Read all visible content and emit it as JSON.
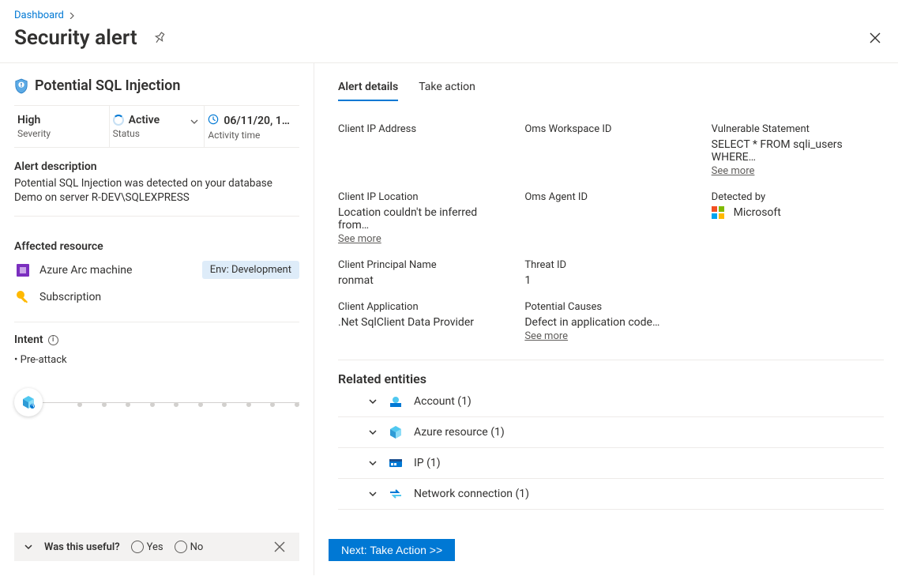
{
  "breadcrumb": {
    "parent": "Dashboard"
  },
  "page_title": "Security alert",
  "alert": {
    "title": "Potential SQL Injection",
    "severity": {
      "value": "High",
      "label": "Severity"
    },
    "status": {
      "value": "Active",
      "label": "Status"
    },
    "activity": {
      "value": "06/11/20, 1…",
      "label": "Activity time"
    },
    "description_h": "Alert description",
    "description": "Potential SQL Injection was detected on your database Demo on server R-DEV\\SQLEXPRESS",
    "affected_h": "Affected resource",
    "resources": [
      {
        "label": "Azure Arc machine",
        "tag": "Env: Development"
      },
      {
        "label": "Subscription"
      }
    ],
    "intent_h": "Intent",
    "intent_value": "Pre-attack"
  },
  "useful_bar": {
    "label": "Was this useful?",
    "yes": "Yes",
    "no": "No"
  },
  "tabs": {
    "details": "Alert details",
    "action": "Take action"
  },
  "details": {
    "client_ip_label": "Client IP Address",
    "client_ip_value": "",
    "oms_ws_label": "Oms Workspace ID",
    "oms_ws_value": "",
    "vuln_label": "Vulnerable Statement",
    "vuln_value": "SELECT * FROM sqli_users WHERE…",
    "client_loc_label": "Client IP Location",
    "client_loc_value": "Location couldn't be inferred from…",
    "oms_agent_label": "Oms Agent ID",
    "oms_agent_value": "",
    "detected_label": "Detected by",
    "detected_value": "Microsoft",
    "principal_label": "Client Principal Name",
    "principal_value": "ronmat",
    "threat_label": "Threat ID",
    "threat_value": "1",
    "client_app_label": "Client Application",
    "client_app_value": ".Net SqlClient Data Provider",
    "causes_label": "Potential Causes",
    "causes_value": "Defect in application code…",
    "see_more": "See more"
  },
  "entities": {
    "header": "Related entities",
    "rows": [
      {
        "label": "Account (1)"
      },
      {
        "label": "Azure resource (1)"
      },
      {
        "label": "IP (1)"
      },
      {
        "label": "Network connection (1)"
      }
    ]
  },
  "next_button": "Next: Take Action  >>"
}
